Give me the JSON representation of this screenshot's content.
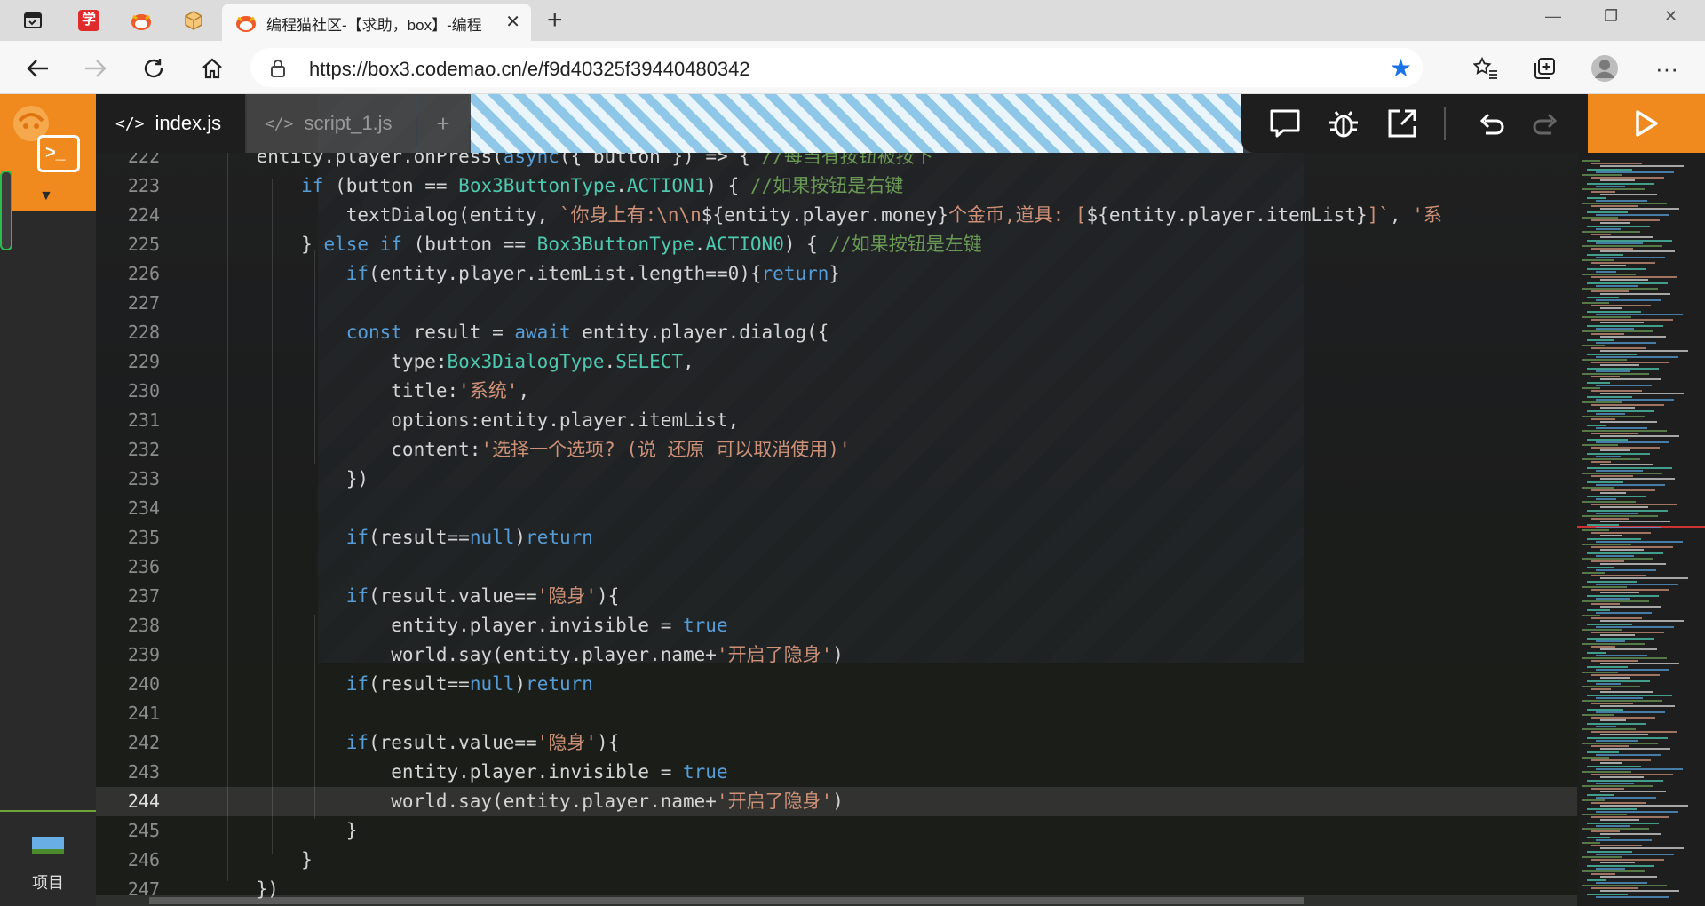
{
  "browser": {
    "tab_title": "编程猫社区-【求助，box】-编程",
    "url": "https://box3.codemao.cn/e/f9d40325f39440480342",
    "pinned_tabs": [
      "tab-actions-icon",
      "xue-icon",
      "codemao-icon",
      "box-icon"
    ],
    "pinned_tab_2_text": "学"
  },
  "ide": {
    "tabs": [
      {
        "label": "index.js",
        "active": true
      },
      {
        "label": "script_1.js",
        "active": false
      }
    ],
    "tab_symbol": "</>",
    "add_tab_label": "+",
    "sidebar": {
      "project_label": "项目"
    },
    "toolbar_icons": [
      "comment-icon",
      "debug-bug-icon",
      "expand-icon",
      "undo-icon",
      "redo-icon",
      "run-play-icon"
    ],
    "current_line": 244
  },
  "code_lines": [
    {
      "n": 222,
      "html": "<span class='i'>    </span>entity.player.onPress(<span class='k'>async</span>({ button }) => { <span class='c'>//每当有按钮被按下</span>"
    },
    {
      "n": 223,
      "html": "        <span class='k'>if</span> (button == <span class='t'>Box3ButtonType</span>.<span class='t'>ACTION1</span>) { <span class='c'>//如果按钮是右键</span>"
    },
    {
      "n": 224,
      "html": "            textDialog(entity, <span class='s'>`你身上有:\\n\\n</span>${entity.player.money}<span class='s'>个金币,道具: [</span>${entity.player.itemList}<span class='s'>]`</span>, <span class='s'>'系</span>"
    },
    {
      "n": 225,
      "html": "        } <span class='k'>else if</span> (button == <span class='t'>Box3ButtonType</span>.<span class='t'>ACTION0</span>) { <span class='c'>//如果按钮是左键</span>"
    },
    {
      "n": 226,
      "html": "            <span class='k'>if</span>(entity.player.itemList.length==0){<span class='k'>return</span>}"
    },
    {
      "n": 227,
      "html": ""
    },
    {
      "n": 228,
      "html": "            <span class='k'>const</span> result = <span class='k'>await</span> entity.player.dialog({"
    },
    {
      "n": 229,
      "html": "                type:<span class='t'>Box3DialogType</span>.<span class='t'>SELECT</span>,"
    },
    {
      "n": 230,
      "html": "                title:<span class='s'>'系统'</span>,"
    },
    {
      "n": 231,
      "html": "                options:entity.player.itemList,"
    },
    {
      "n": 232,
      "html": "                content:<span class='s'>'选择一个选项? (说 还原 可以取消使用)'</span>"
    },
    {
      "n": 233,
      "html": "            })"
    },
    {
      "n": 234,
      "html": ""
    },
    {
      "n": 235,
      "html": "            <span class='k'>if</span>(result==<span class='k'>null</span>)<span class='k'>return</span>"
    },
    {
      "n": 236,
      "html": ""
    },
    {
      "n": 237,
      "html": "            <span class='k'>if</span>(result.value==<span class='s'>'隐身'</span>){"
    },
    {
      "n": 238,
      "html": "                entity.player.invisible = <span class='k'>true</span>"
    },
    {
      "n": 239,
      "html": "                world.say(entity.player.name+<span class='s'>'开启了隐身'</span>)"
    },
    {
      "n": 240,
      "html": "            <span class='k'>if</span>(result==<span class='k'>null</span>)<span class='k'>return</span>"
    },
    {
      "n": 241,
      "html": ""
    },
    {
      "n": 242,
      "html": "            <span class='k'>if</span>(result.value==<span class='s'>'隐身'</span>){"
    },
    {
      "n": 243,
      "html": "                entity.player.invisible = <span class='k'>true</span>"
    },
    {
      "n": 244,
      "html": "                world.say(entity.player.name+<span class='s'>'开启了隐身'</span>)"
    },
    {
      "n": 245,
      "html": "            }"
    },
    {
      "n": 246,
      "html": "        }"
    },
    {
      "n": 247,
      "html": "    })"
    }
  ]
}
